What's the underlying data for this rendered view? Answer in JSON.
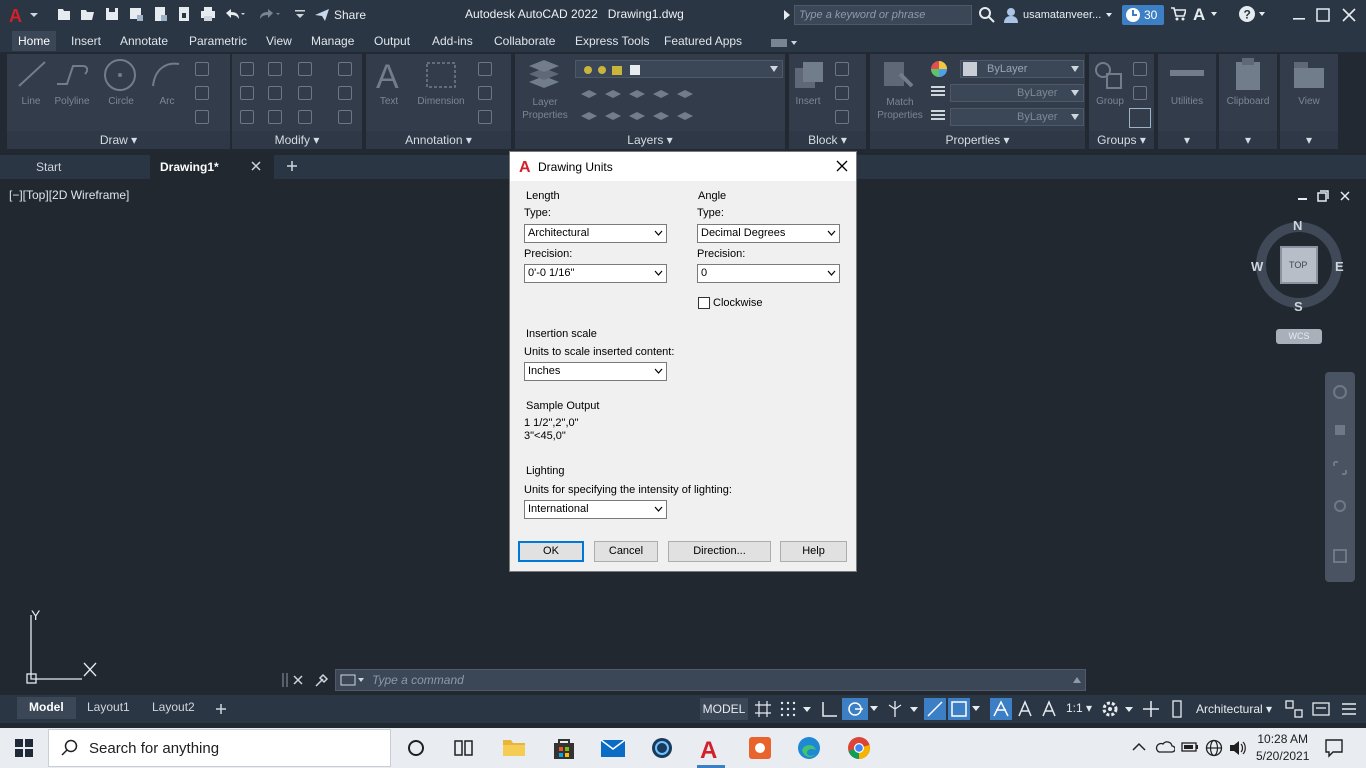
{
  "titlebar": {
    "share_label": "Share",
    "app_title": "Autodesk AutoCAD 2022",
    "file_name": "Drawing1.dwg",
    "search_placeholder": "Type a keyword or phrase",
    "username": "usamatanveer...",
    "timer_value": "30"
  },
  "ribbon_tabs": [
    "Home",
    "Insert",
    "Annotate",
    "Parametric",
    "View",
    "Manage",
    "Output",
    "Add-ins",
    "Collaborate",
    "Express Tools",
    "Featured Apps"
  ],
  "ribbon": {
    "draw_tools": [
      "Line",
      "Polyline",
      "Circle",
      "Arc"
    ],
    "annotation_tools": [
      "Text",
      "Dimension"
    ],
    "layer_tool": "Layer Properties",
    "block_tool": "Insert",
    "properties_tools": [
      "Match Properties"
    ],
    "bylayer_values": [
      "ByLayer",
      "ByLayer",
      "ByLayer"
    ],
    "group_tool": "Group",
    "utilities_label": "Utilities",
    "clipboard_label": "Clipboard",
    "view_label": "View",
    "panels": [
      "Draw",
      "Modify",
      "Annotation",
      "Layers",
      "Block",
      "Properties",
      "Groups"
    ]
  },
  "doc_tabs": [
    "Start",
    "Drawing1*"
  ],
  "viewport_label": "[−][Top][2D Wireframe]",
  "viewcube": {
    "n": "N",
    "s": "S",
    "e": "E",
    "w": "W",
    "face": "TOP",
    "wcs": "WCS"
  },
  "ucs": {
    "y": "Y"
  },
  "command_placeholder": "Type a command",
  "layout_tabs": [
    "Model",
    "Layout1",
    "Layout2"
  ],
  "status": {
    "model": "MODEL",
    "scale": "1:1",
    "units": "Architectural"
  },
  "dialog": {
    "title": "Drawing Units",
    "length": {
      "heading": "Length",
      "type_label": "Type:",
      "type_value": "Architectural",
      "precision_label": "Precision:",
      "precision_value": "0'-0 1/16\""
    },
    "angle": {
      "heading": "Angle",
      "type_label": "Type:",
      "type_value": "Decimal Degrees",
      "precision_label": "Precision:",
      "precision_value": "0",
      "clockwise_label": "Clockwise",
      "clockwise_checked": false
    },
    "insertion": {
      "heading": "Insertion scale",
      "sub_label": "Units to scale inserted content:",
      "value": "Inches"
    },
    "sample": {
      "heading": "Sample Output",
      "line1": "1 1/2\",2\",0\"",
      "line2": "3\"<45,0\""
    },
    "lighting": {
      "heading": "Lighting",
      "sub_label": "Units for specifying the intensity of lighting:",
      "value": "International"
    },
    "buttons": {
      "ok": "OK",
      "cancel": "Cancel",
      "direction": "Direction...",
      "help": "Help"
    }
  },
  "taskbar": {
    "search_placeholder": "Search for anything",
    "time": "10:28 AM",
    "date": "5/20/2021"
  },
  "colors": {
    "accent": "#3c7fc4",
    "titlebar": "#2b3644",
    "canvas": "#212830",
    "autocad_red": "#d3212b"
  }
}
